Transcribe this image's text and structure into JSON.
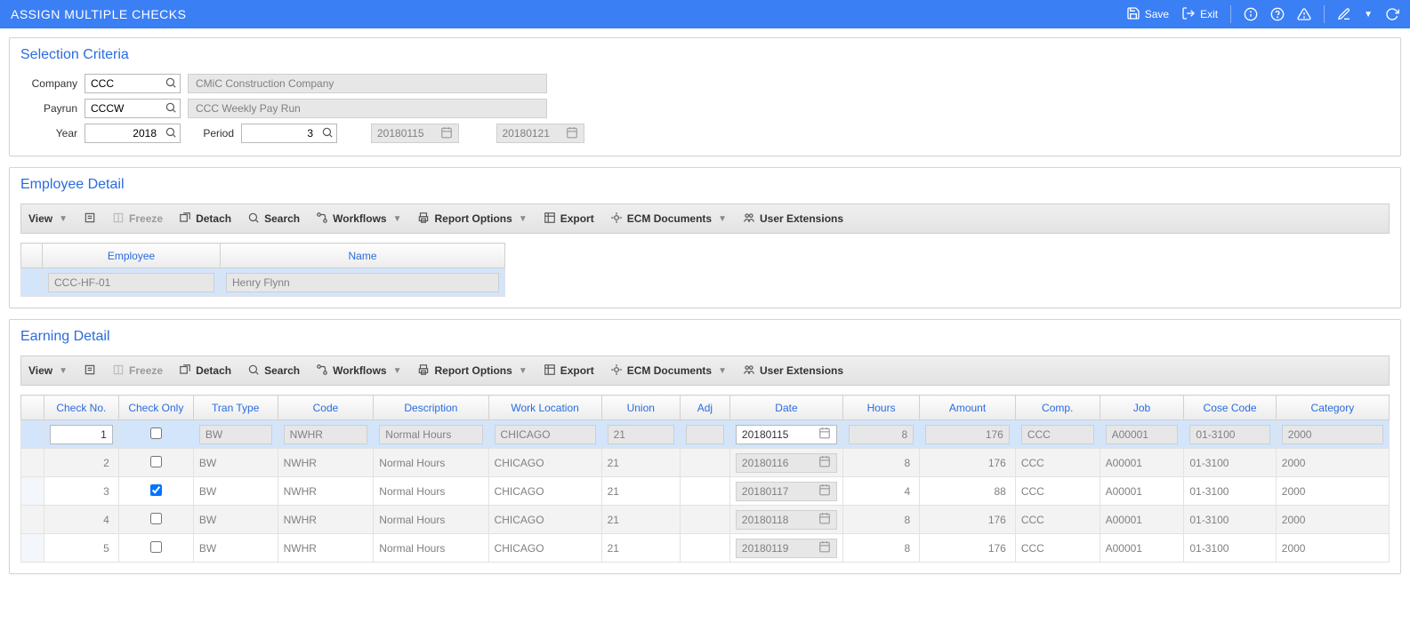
{
  "titlebar": {
    "title": "ASSIGN MULTIPLE CHECKS",
    "save_label": "Save",
    "exit_label": "Exit"
  },
  "selection": {
    "header": "Selection Criteria",
    "labels": {
      "company": "Company",
      "payrun": "Payrun",
      "year": "Year",
      "period": "Period"
    },
    "company": {
      "value": "CCC",
      "desc": "CMiC Construction Company"
    },
    "payrun": {
      "value": "CCCW",
      "desc": "CCC Weekly Pay Run"
    },
    "year": "2018",
    "period": "3",
    "period_start": "20180115",
    "period_end": "20180121"
  },
  "employee_detail": {
    "header": "Employee Detail",
    "columns": {
      "employee": "Employee",
      "name": "Name"
    },
    "rows": [
      {
        "employee": "CCC-HF-01",
        "name": "Henry Flynn"
      }
    ]
  },
  "earning_detail": {
    "header": "Earning Detail",
    "columns": {
      "check_no": "Check No.",
      "check_only": "Check Only",
      "tran_type": "Tran Type",
      "code": "Code",
      "description": "Description",
      "work_location": "Work Location",
      "union": "Union",
      "adj": "Adj",
      "date": "Date",
      "hours": "Hours",
      "amount": "Amount",
      "comp": "Comp.",
      "job": "Job",
      "cose_code": "Cose Code",
      "category": "Category"
    },
    "rows": [
      {
        "check_no": "1",
        "check_only": false,
        "tran_type": "BW",
        "code": "NWHR",
        "description": "Normal Hours",
        "work_location": "CHICAGO",
        "union": "21",
        "adj": "",
        "date": "20180115",
        "hours": "8",
        "amount": "176",
        "comp": "CCC",
        "job": "A00001",
        "cose_code": "01-3100",
        "category": "2000",
        "selected": true,
        "editable": true
      },
      {
        "check_no": "2",
        "check_only": false,
        "tran_type": "BW",
        "code": "NWHR",
        "description": "Normal Hours",
        "work_location": "CHICAGO",
        "union": "21",
        "adj": "",
        "date": "20180116",
        "hours": "8",
        "amount": "176",
        "comp": "CCC",
        "job": "A00001",
        "cose_code": "01-3100",
        "category": "2000",
        "alt": true
      },
      {
        "check_no": "3",
        "check_only": true,
        "tran_type": "BW",
        "code": "NWHR",
        "description": "Normal Hours",
        "work_location": "CHICAGO",
        "union": "21",
        "adj": "",
        "date": "20180117",
        "hours": "4",
        "amount": "88",
        "comp": "CCC",
        "job": "A00001",
        "cose_code": "01-3100",
        "category": "2000"
      },
      {
        "check_no": "4",
        "check_only": false,
        "tran_type": "BW",
        "code": "NWHR",
        "description": "Normal Hours",
        "work_location": "CHICAGO",
        "union": "21",
        "adj": "",
        "date": "20180118",
        "hours": "8",
        "amount": "176",
        "comp": "CCC",
        "job": "A00001",
        "cose_code": "01-3100",
        "category": "2000",
        "alt": true
      },
      {
        "check_no": "5",
        "check_only": false,
        "tran_type": "BW",
        "code": "NWHR",
        "description": "Normal Hours",
        "work_location": "CHICAGO",
        "union": "21",
        "adj": "",
        "date": "20180119",
        "hours": "8",
        "amount": "176",
        "comp": "CCC",
        "job": "A00001",
        "cose_code": "01-3100",
        "category": "2000"
      }
    ]
  },
  "toolbar": {
    "view": "View",
    "freeze": "Freeze",
    "detach": "Detach",
    "search": "Search",
    "workflows": "Workflows",
    "report_options": "Report Options",
    "export": "Export",
    "ecm_documents": "ECM Documents",
    "user_extensions": "User Extensions"
  }
}
